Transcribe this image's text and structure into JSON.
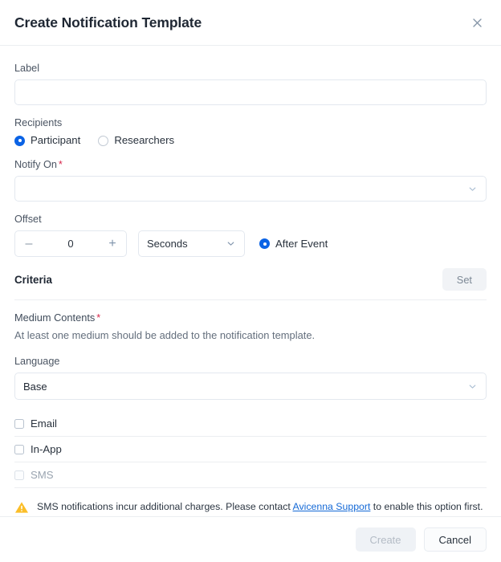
{
  "dialog": {
    "title": "Create Notification Template",
    "close_icon": "close-icon"
  },
  "label_field": {
    "label": "Label",
    "value": "",
    "placeholder": ""
  },
  "recipients": {
    "label": "Recipients",
    "options": [
      {
        "label": "Participant",
        "selected": true
      },
      {
        "label": "Researchers",
        "selected": false
      }
    ]
  },
  "notify_on": {
    "label": "Notify On",
    "required_mark": "*",
    "value": "",
    "chevron_icon": "chevron-down-icon"
  },
  "offset": {
    "label": "Offset",
    "value": "0",
    "minus_label": "–",
    "plus_label": "+",
    "unit": "Seconds",
    "unit_chevron_icon": "chevron-down-icon",
    "timing": {
      "label": "After Event",
      "selected": true
    }
  },
  "criteria": {
    "title": "Criteria",
    "set_label": "Set"
  },
  "medium_contents": {
    "label": "Medium Contents",
    "required_mark": "*",
    "description": "At least one medium should be added to the notification template."
  },
  "language": {
    "label": "Language",
    "value": "Base",
    "chevron_icon": "chevron-down-icon"
  },
  "mediums": [
    {
      "label": "Email",
      "checked": false,
      "disabled": false
    },
    {
      "label": "In-App",
      "checked": false,
      "disabled": false
    },
    {
      "label": "SMS",
      "checked": false,
      "disabled": true
    }
  ],
  "warning": {
    "icon": "warning-triangle-icon",
    "text_before": "SMS notifications incur additional charges. Please contact ",
    "link_text": "Avicenna Support",
    "text_after": " to enable this option first."
  },
  "footer": {
    "create_label": "Create",
    "cancel_label": "Cancel"
  },
  "colors": {
    "accent_blue": "#0b63e5",
    "link_blue": "#1469d6",
    "required_red": "#d6264a",
    "warning_amber": "#fbbe28",
    "border": "#e3e8ef",
    "divider": "#eceef1"
  }
}
